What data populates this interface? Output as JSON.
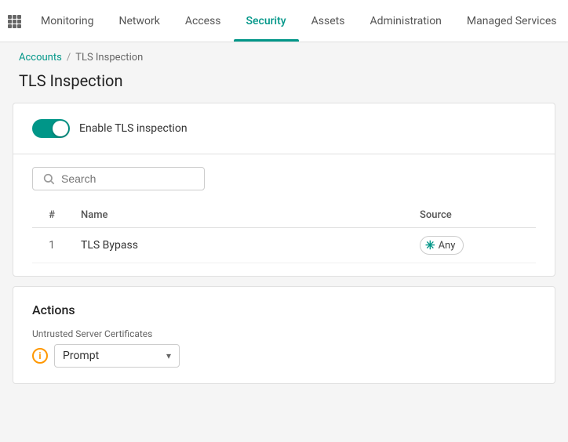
{
  "nav": {
    "items": [
      {
        "id": "monitoring",
        "label": "Monitoring",
        "active": false
      },
      {
        "id": "network",
        "label": "Network",
        "active": false
      },
      {
        "id": "access",
        "label": "Access",
        "active": false
      },
      {
        "id": "security",
        "label": "Security",
        "active": true
      },
      {
        "id": "assets",
        "label": "Assets",
        "active": false
      },
      {
        "id": "administration",
        "label": "Administration",
        "active": false
      },
      {
        "id": "managed-services",
        "label": "Managed Services",
        "active": false
      }
    ]
  },
  "breadcrumb": {
    "parent": "Accounts",
    "current": "TLS Inspection",
    "separator": "/"
  },
  "page": {
    "title": "TLS Inspection"
  },
  "toggle": {
    "label": "Enable TLS inspection",
    "enabled": true
  },
  "search": {
    "placeholder": "Search"
  },
  "table": {
    "columns": [
      {
        "id": "num",
        "label": "#"
      },
      {
        "id": "name",
        "label": "Name"
      },
      {
        "id": "source",
        "label": "Source"
      }
    ],
    "rows": [
      {
        "num": 1,
        "name": "TLS Bypass",
        "source": "Any"
      }
    ]
  },
  "actions": {
    "title": "Actions",
    "untrusted_label": "Untrusted Server Certificates",
    "prompt_value": "Prompt"
  },
  "colors": {
    "accent": "#009688",
    "warning": "#ff9800"
  }
}
